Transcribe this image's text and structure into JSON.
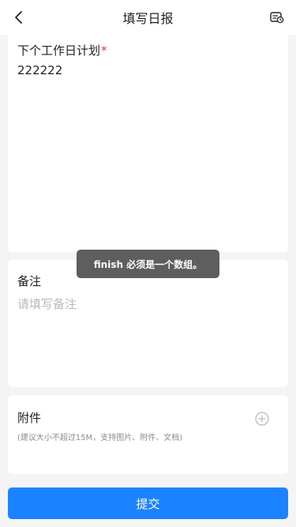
{
  "header": {
    "title": "填写日报",
    "back_icon": "chevron-left-icon",
    "history_icon": "calendar-clock-icon"
  },
  "plan": {
    "label": "下个工作日计划",
    "required_mark": "*",
    "value": "222222"
  },
  "remark": {
    "label": "备注",
    "placeholder": "请填写备注"
  },
  "attachment": {
    "label": "附件",
    "hint": "(建议大小不超过15M，支持图片、附件、文档)",
    "add_icon": "plus-circle-icon"
  },
  "toast": {
    "message": "finish 必须是一个数组。"
  },
  "submit": {
    "label": "提交"
  },
  "colors": {
    "primary": "#1b83ff",
    "required": "#e03b3b",
    "background": "#f4f4f5"
  }
}
